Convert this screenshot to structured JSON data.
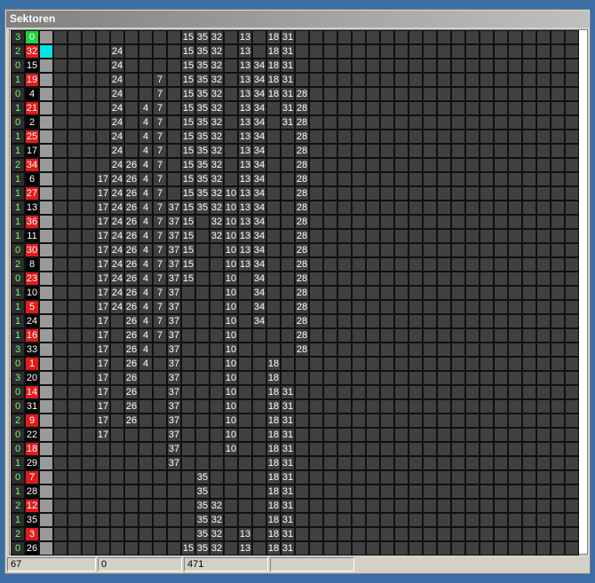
{
  "window": {
    "title": "Sektoren"
  },
  "status": [
    "67",
    "0",
    "471",
    ""
  ],
  "colors": {
    "red": "#e11b1b",
    "green": "#1fd13a",
    "cyan": "#00e5e5",
    "count_text": "#7cf17c",
    "cell_bg": "#404040"
  },
  "columns": [
    37,
    15,
    32,
    17,
    24,
    26,
    4,
    7,
    37,
    15,
    35,
    32,
    10,
    13,
    34,
    18,
    31,
    28
  ],
  "rows": [
    {
      "count": "3",
      "id": "0",
      "id_color": "green",
      "marker": "gray",
      "present": [
        0,
        0,
        0,
        0,
        0,
        0,
        0,
        0,
        0,
        1,
        1,
        1,
        0,
        1,
        0,
        1,
        1,
        0
      ]
    },
    {
      "count": "2",
      "id": "32",
      "id_color": "red",
      "marker": "cyan",
      "present": [
        0,
        0,
        0,
        0,
        1,
        0,
        0,
        0,
        0,
        1,
        1,
        1,
        0,
        1,
        0,
        1,
        1,
        0
      ]
    },
    {
      "count": "0",
      "id": "15",
      "id_color": "black",
      "marker": "gray",
      "present": [
        0,
        0,
        0,
        0,
        1,
        0,
        0,
        0,
        0,
        1,
        1,
        1,
        0,
        1,
        1,
        1,
        1,
        0
      ]
    },
    {
      "count": "1",
      "id": "19",
      "id_color": "red",
      "marker": "gray",
      "present": [
        0,
        0,
        0,
        0,
        1,
        0,
        0,
        1,
        0,
        1,
        1,
        1,
        0,
        1,
        1,
        1,
        1,
        0
      ]
    },
    {
      "count": "0",
      "id": "4",
      "id_color": "black",
      "marker": "gray",
      "present": [
        0,
        0,
        0,
        0,
        1,
        0,
        0,
        1,
        0,
        1,
        1,
        1,
        0,
        1,
        1,
        1,
        1,
        1
      ]
    },
    {
      "count": "1",
      "id": "21",
      "id_color": "red",
      "marker": "gray",
      "present": [
        0,
        0,
        0,
        0,
        1,
        0,
        1,
        1,
        0,
        1,
        1,
        1,
        0,
        1,
        1,
        0,
        1,
        1
      ]
    },
    {
      "count": "0",
      "id": "2",
      "id_color": "black",
      "marker": "gray",
      "present": [
        0,
        0,
        0,
        0,
        1,
        0,
        1,
        1,
        0,
        1,
        1,
        1,
        0,
        1,
        1,
        0,
        1,
        1
      ]
    },
    {
      "count": "1",
      "id": "25",
      "id_color": "red",
      "marker": "gray",
      "present": [
        0,
        0,
        0,
        0,
        1,
        0,
        1,
        1,
        0,
        1,
        1,
        1,
        0,
        1,
        1,
        0,
        0,
        1
      ]
    },
    {
      "count": "1",
      "id": "17",
      "id_color": "black",
      "marker": "gray",
      "present": [
        0,
        0,
        0,
        0,
        1,
        0,
        1,
        1,
        0,
        1,
        1,
        1,
        0,
        1,
        1,
        0,
        0,
        1
      ]
    },
    {
      "count": "2",
      "id": "34",
      "id_color": "red",
      "marker": "gray",
      "present": [
        0,
        0,
        0,
        0,
        1,
        1,
        1,
        1,
        0,
        1,
        1,
        1,
        0,
        1,
        1,
        0,
        0,
        1
      ]
    },
    {
      "count": "1",
      "id": "6",
      "id_color": "black",
      "marker": "gray",
      "present": [
        0,
        0,
        0,
        1,
        1,
        1,
        1,
        1,
        0,
        1,
        1,
        1,
        0,
        1,
        1,
        0,
        0,
        1
      ]
    },
    {
      "count": "1",
      "id": "27",
      "id_color": "red",
      "marker": "gray",
      "present": [
        0,
        0,
        0,
        1,
        1,
        1,
        1,
        1,
        0,
        1,
        1,
        1,
        1,
        1,
        1,
        0,
        0,
        1
      ]
    },
    {
      "count": "1",
      "id": "13",
      "id_color": "black",
      "marker": "gray",
      "present": [
        0,
        0,
        0,
        1,
        1,
        1,
        1,
        1,
        1,
        1,
        1,
        1,
        1,
        1,
        1,
        0,
        0,
        1
      ]
    },
    {
      "count": "1",
      "id": "36",
      "id_color": "red",
      "marker": "gray",
      "present": [
        0,
        0,
        0,
        1,
        1,
        1,
        1,
        1,
        1,
        1,
        0,
        1,
        1,
        1,
        1,
        0,
        0,
        1
      ]
    },
    {
      "count": "1",
      "id": "11",
      "id_color": "black",
      "marker": "gray",
      "present": [
        0,
        0,
        0,
        1,
        1,
        1,
        1,
        1,
        1,
        1,
        0,
        1,
        1,
        1,
        1,
        0,
        0,
        1
      ]
    },
    {
      "count": "0",
      "id": "30",
      "id_color": "red",
      "marker": "gray",
      "present": [
        0,
        0,
        0,
        1,
        1,
        1,
        1,
        1,
        1,
        1,
        0,
        0,
        1,
        1,
        1,
        0,
        0,
        1
      ]
    },
    {
      "count": "2",
      "id": "8",
      "id_color": "black",
      "marker": "gray",
      "present": [
        0,
        0,
        0,
        1,
        1,
        1,
        1,
        1,
        1,
        1,
        0,
        0,
        1,
        1,
        1,
        0,
        0,
        1
      ]
    },
    {
      "count": "0",
      "id": "23",
      "id_color": "red",
      "marker": "gray",
      "present": [
        0,
        0,
        0,
        1,
        1,
        1,
        1,
        1,
        1,
        1,
        0,
        0,
        1,
        0,
        1,
        0,
        0,
        1
      ]
    },
    {
      "count": "1",
      "id": "10",
      "id_color": "black",
      "marker": "gray",
      "present": [
        0,
        0,
        0,
        1,
        1,
        1,
        1,
        1,
        1,
        0,
        0,
        0,
        1,
        0,
        1,
        0,
        0,
        1
      ]
    },
    {
      "count": "1",
      "id": "5",
      "id_color": "red",
      "marker": "gray",
      "present": [
        0,
        0,
        0,
        1,
        1,
        1,
        1,
        1,
        1,
        0,
        0,
        0,
        1,
        0,
        1,
        0,
        0,
        1
      ]
    },
    {
      "count": "1",
      "id": "24",
      "id_color": "black",
      "marker": "gray",
      "present": [
        0,
        0,
        0,
        1,
        0,
        1,
        1,
        1,
        1,
        0,
        0,
        0,
        1,
        0,
        1,
        0,
        0,
        1
      ]
    },
    {
      "count": "1",
      "id": "16",
      "id_color": "red",
      "marker": "gray",
      "present": [
        0,
        0,
        0,
        1,
        0,
        1,
        1,
        1,
        1,
        0,
        0,
        0,
        1,
        0,
        0,
        0,
        0,
        1
      ]
    },
    {
      "count": "3",
      "id": "33",
      "id_color": "black",
      "marker": "gray",
      "present": [
        0,
        0,
        0,
        1,
        0,
        1,
        1,
        0,
        1,
        0,
        0,
        0,
        1,
        0,
        0,
        0,
        0,
        1
      ]
    },
    {
      "count": "0",
      "id": "1",
      "id_color": "red",
      "marker": "gray",
      "present": [
        0,
        0,
        0,
        1,
        0,
        1,
        1,
        0,
        1,
        0,
        0,
        0,
        1,
        0,
        0,
        1,
        0,
        0
      ]
    },
    {
      "count": "3",
      "id": "20",
      "id_color": "black",
      "marker": "gray",
      "present": [
        0,
        0,
        0,
        1,
        0,
        1,
        0,
        0,
        1,
        0,
        0,
        0,
        1,
        0,
        0,
        1,
        0,
        0
      ]
    },
    {
      "count": "0",
      "id": "14",
      "id_color": "red",
      "marker": "gray",
      "present": [
        0,
        0,
        0,
        1,
        0,
        1,
        0,
        0,
        1,
        0,
        0,
        0,
        1,
        0,
        0,
        1,
        1,
        0
      ]
    },
    {
      "count": "0",
      "id": "31",
      "id_color": "black",
      "marker": "gray",
      "present": [
        0,
        0,
        0,
        1,
        0,
        1,
        0,
        0,
        1,
        0,
        0,
        0,
        1,
        0,
        0,
        1,
        1,
        0
      ]
    },
    {
      "count": "2",
      "id": "9",
      "id_color": "red",
      "marker": "gray",
      "present": [
        0,
        0,
        0,
        1,
        0,
        1,
        0,
        0,
        1,
        0,
        0,
        0,
        1,
        0,
        0,
        1,
        1,
        0
      ]
    },
    {
      "count": "0",
      "id": "22",
      "id_color": "black",
      "marker": "gray",
      "present": [
        0,
        0,
        0,
        1,
        0,
        0,
        0,
        0,
        1,
        0,
        0,
        0,
        1,
        0,
        0,
        1,
        1,
        0
      ]
    },
    {
      "count": "0",
      "id": "18",
      "id_color": "red",
      "marker": "gray",
      "present": [
        0,
        0,
        0,
        0,
        0,
        0,
        0,
        0,
        1,
        0,
        0,
        0,
        1,
        0,
        0,
        1,
        1,
        0
      ]
    },
    {
      "count": "1",
      "id": "29",
      "id_color": "black",
      "marker": "gray",
      "present": [
        0,
        0,
        0,
        0,
        0,
        0,
        0,
        0,
        1,
        0,
        0,
        0,
        0,
        0,
        0,
        1,
        1,
        0
      ]
    },
    {
      "count": "0",
      "id": "7",
      "id_color": "red",
      "marker": "gray",
      "present": [
        0,
        0,
        0,
        0,
        0,
        0,
        0,
        0,
        0,
        0,
        1,
        0,
        0,
        0,
        0,
        1,
        1,
        0
      ]
    },
    {
      "count": "1",
      "id": "28",
      "id_color": "black",
      "marker": "gray",
      "present": [
        0,
        0,
        0,
        0,
        0,
        0,
        0,
        0,
        0,
        0,
        1,
        0,
        0,
        0,
        0,
        1,
        1,
        0
      ]
    },
    {
      "count": "2",
      "id": "12",
      "id_color": "red",
      "marker": "gray",
      "present": [
        0,
        0,
        0,
        0,
        0,
        0,
        0,
        0,
        0,
        0,
        1,
        1,
        0,
        0,
        0,
        1,
        1,
        0
      ]
    },
    {
      "count": "1",
      "id": "35",
      "id_color": "black",
      "marker": "gray",
      "present": [
        0,
        0,
        0,
        0,
        0,
        0,
        0,
        0,
        0,
        0,
        1,
        1,
        0,
        0,
        0,
        1,
        1,
        0
      ]
    },
    {
      "count": "2",
      "id": "3",
      "id_color": "red",
      "marker": "gray",
      "present": [
        0,
        0,
        0,
        0,
        0,
        0,
        0,
        0,
        0,
        0,
        1,
        1,
        0,
        1,
        0,
        1,
        1,
        0
      ]
    },
    {
      "count": "0",
      "id": "26",
      "id_color": "black",
      "marker": "gray",
      "present": [
        0,
        0,
        0,
        0,
        0,
        0,
        0,
        0,
        0,
        1,
        1,
        1,
        0,
        1,
        0,
        1,
        1,
        0
      ]
    }
  ]
}
